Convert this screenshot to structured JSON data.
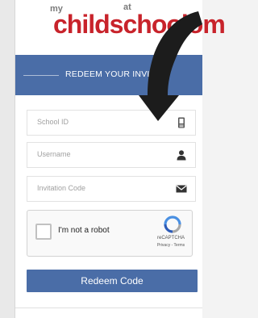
{
  "logo": {
    "my": "my",
    "main": "childschool",
    "at": "at",
    "suffix": "om"
  },
  "banner": {
    "title": "REDEEM YOUR INVI"
  },
  "form": {
    "school_id_placeholder": "School ID",
    "username_placeholder": "Username",
    "invitation_code_placeholder": "Invitation Code"
  },
  "captcha": {
    "label": "I'm not a robot",
    "brand": "reCAPTCHA",
    "terms": "Privacy - Terms"
  },
  "redeem_button": {
    "label": "Redeem Code"
  },
  "colors": {
    "brand_red": "#c8232b",
    "primary_blue": "#4a6da7",
    "arrow": "#1c1c1c"
  },
  "icons": [
    "id-card-icon",
    "user-icon",
    "envelope-icon",
    "recaptcha-icon",
    "curved-arrow-icon"
  ]
}
